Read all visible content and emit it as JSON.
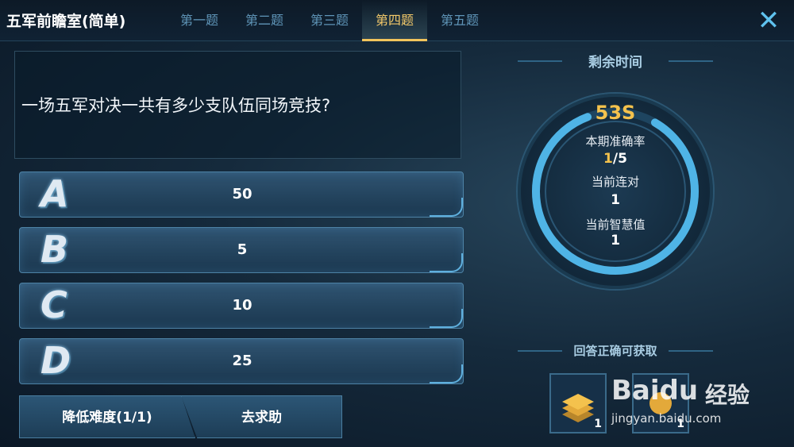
{
  "header": {
    "title": "五军前瞻室(简单)",
    "tabs": [
      "第一题",
      "第二题",
      "第三题",
      "第四题",
      "第五题"
    ],
    "active_tab_index": 3,
    "close_icon": "close-icon"
  },
  "question": {
    "text": "一场五军对决一共有多少支队伍同场竞技?"
  },
  "options": [
    {
      "letter": "A",
      "value": "50"
    },
    {
      "letter": "B",
      "value": "5"
    },
    {
      "letter": "C",
      "value": "10"
    },
    {
      "letter": "D",
      "value": "25"
    }
  ],
  "actions": {
    "reduce_difficulty": "降低难度(1/1)",
    "ask_help": "去求助"
  },
  "timer": {
    "label": "剩余时间",
    "seconds": "53S",
    "accuracy_label": "本期准确率",
    "accuracy_correct": "1",
    "accuracy_total": "/5",
    "streak_label": "当前连对",
    "streak_value": "1",
    "wisdom_label": "当前智慧值",
    "wisdom_value": "1"
  },
  "reward": {
    "label": "回答正确可获取",
    "items": [
      {
        "icon": "stacked-coins-icon",
        "count": "1"
      },
      {
        "icon": "coin-icon",
        "count": "1"
      }
    ]
  },
  "watermark": {
    "brand": "Baidu",
    "cn": "经验",
    "url": "jingyan.baidu.com"
  },
  "colors": {
    "accent": "#f4c24d",
    "tab_inactive": "#5f95b8",
    "ring": "#4fb4e6"
  }
}
